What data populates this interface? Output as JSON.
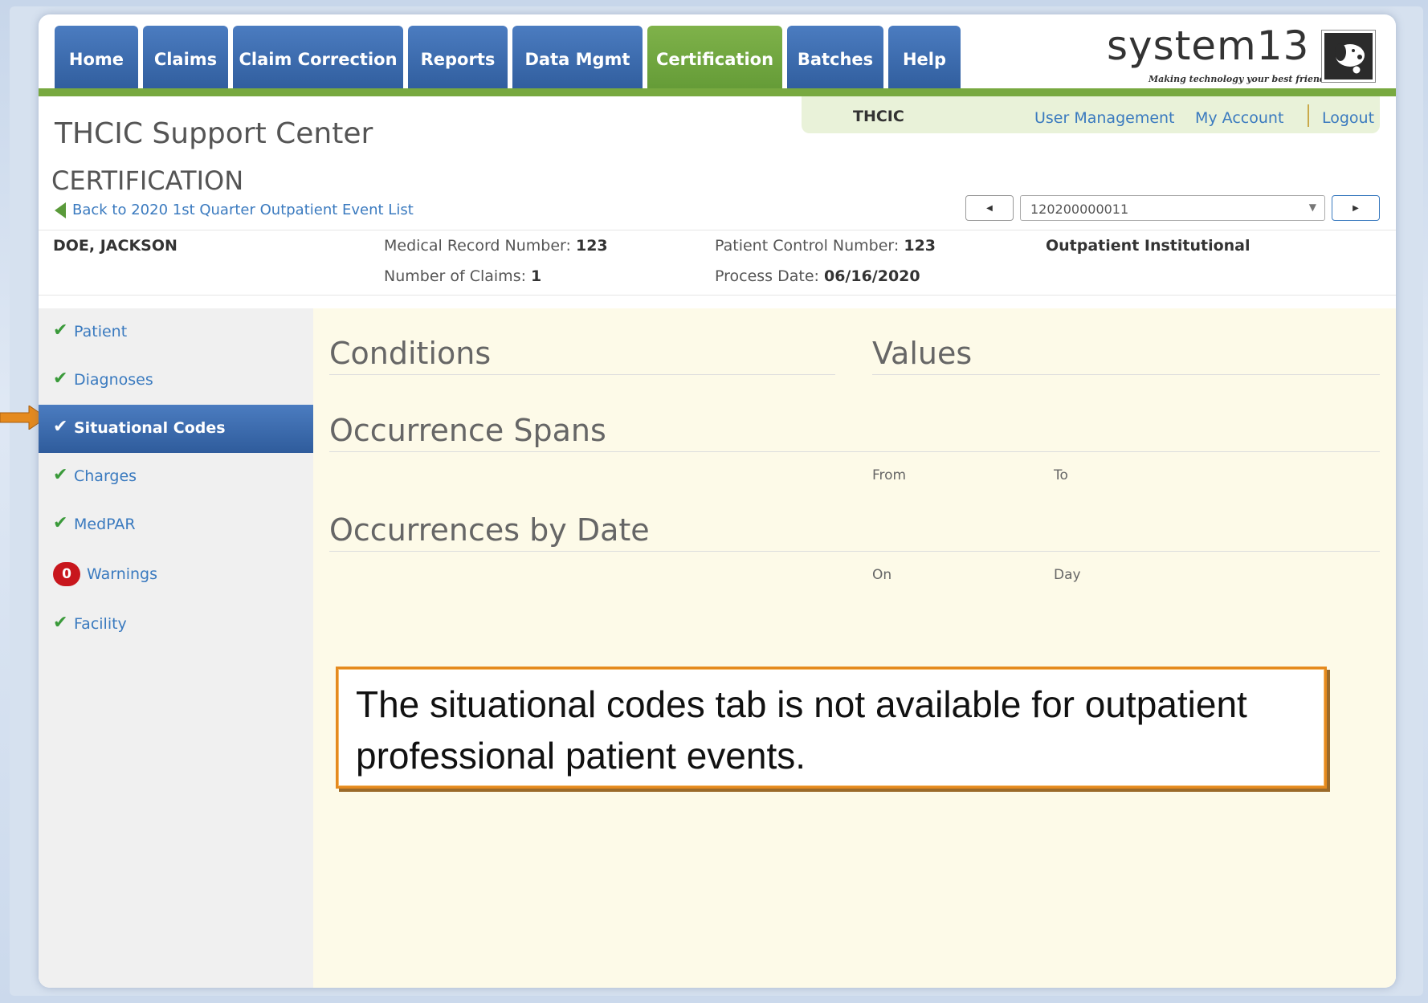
{
  "nav": {
    "tabs": [
      {
        "label": "Home"
      },
      {
        "label": "Claims"
      },
      {
        "label": "Claim Correction"
      },
      {
        "label": "Reports"
      },
      {
        "label": "Data Mgmt"
      },
      {
        "label": "Certification"
      },
      {
        "label": "Batches"
      },
      {
        "label": "Help"
      }
    ],
    "active_tab": "Certification"
  },
  "logo": {
    "word": "system13",
    "tagline": "Making technology your best friend."
  },
  "account": {
    "org": "THCIC",
    "user_management": "User Management",
    "my_account": "My Account",
    "logout": "Logout"
  },
  "header": {
    "title": "THCIC Support Center",
    "section": "CERTIFICATION",
    "back_link": "Back to 2020 1st Quarter Outpatient Event List"
  },
  "pager": {
    "selected": "120200000011"
  },
  "patient": {
    "name": "DOE, JACKSON",
    "mrn_label": "Medical Record Number:",
    "mrn": "123",
    "claims_label": "Number of Claims:",
    "claims": "1",
    "pcn_label": "Patient Control Number:",
    "pcn": "123",
    "process_label": "Process Date:",
    "process_date": "06/16/2020",
    "type": "Outpatient Institutional"
  },
  "sidebar": {
    "items": [
      {
        "label": "Patient"
      },
      {
        "label": "Diagnoses"
      },
      {
        "label": "Situational Codes"
      },
      {
        "label": "Charges"
      },
      {
        "label": "MedPAR"
      },
      {
        "label": "Warnings",
        "count": "0"
      },
      {
        "label": "Facility"
      }
    ]
  },
  "content": {
    "conditions": "Conditions",
    "values": "Values",
    "occurrence_spans": "Occurrence Spans",
    "from": "From",
    "to": "To",
    "occurrences_by_date": "Occurrences by Date",
    "on": "On",
    "day": "Day"
  },
  "callout": {
    "text": "The situational codes tab is not available for outpatient professional patient events."
  },
  "colors": {
    "nav_blue": "#3a68a8",
    "nav_green": "#78a940",
    "link": "#3a7abf",
    "callout_border": "#e58a1e",
    "badge": "#c8161d"
  }
}
